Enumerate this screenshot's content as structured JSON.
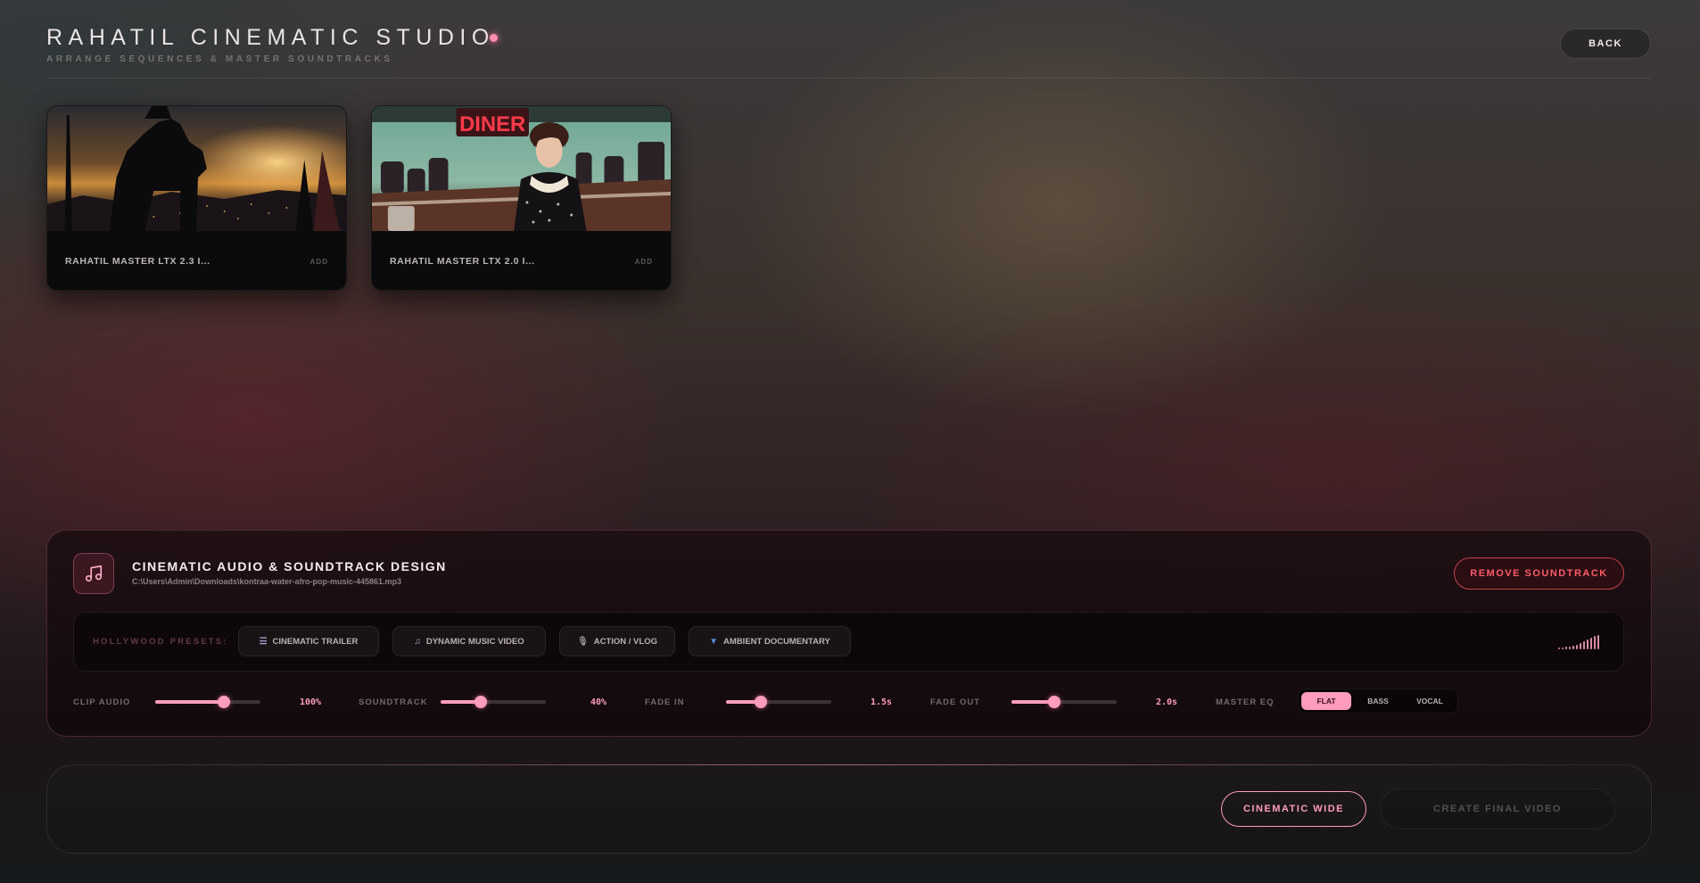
{
  "header": {
    "title": "RAHATIL CINEMATIC STUDIO",
    "subtitle": "ARRANGE SEQUENCES & MASTER SOUNDTRACKS",
    "back_label": "BACK",
    "accent_color": "#ff8fb0"
  },
  "clips": [
    {
      "name": "RAHATIL MASTER LTX 2.3 I...",
      "add_label": "ADD",
      "thumbnail": "horseback-warrior-sunset-city"
    },
    {
      "name": "RAHATIL MASTER LTX 2.0 I...",
      "add_label": "ADD",
      "thumbnail": "diner-waitress",
      "sign_text": "DINER"
    }
  ],
  "audio": {
    "title": "CINEMATIC AUDIO & SOUNDTRACK DESIGN",
    "file_path": "C:\\Users\\Admin\\Downloads\\kontraa-water-afro-pop-music-445861.mp3",
    "remove_label": "REMOVE SOUNDTRACK",
    "icon": "music-note-icon",
    "presets_label": "HOLLYWOOD PRESETS:",
    "presets": [
      {
        "label": "CINEMATIC TRAILER",
        "icon": "film-icon"
      },
      {
        "label": "DYNAMIC MUSIC VIDEO",
        "icon": "music-note-icon"
      },
      {
        "label": "ACTION / VLOG",
        "icon": "microphone-icon"
      },
      {
        "label": "AMBIENT DOCUMENTARY",
        "icon": "droplet-icon"
      }
    ],
    "controls": [
      {
        "label": "CLIP AUDIO",
        "value": "100%",
        "level": 0.65
      },
      {
        "label": "SOUNDTRACK",
        "value": "40%",
        "level": 0.38
      },
      {
        "label": "FADE IN",
        "value": "1.5s",
        "level": 0.33
      },
      {
        "label": "FADE OUT",
        "value": "2.0s",
        "level": 0.41
      }
    ],
    "eq_label": "MASTER EQ",
    "eq_options": [
      "FLAT",
      "BASS",
      "VOCAL"
    ],
    "eq_selected": "FLAT"
  },
  "footer": {
    "aspect_label": "CINEMATIC WIDE",
    "create_label": "CREATE FINAL VIDEO"
  }
}
